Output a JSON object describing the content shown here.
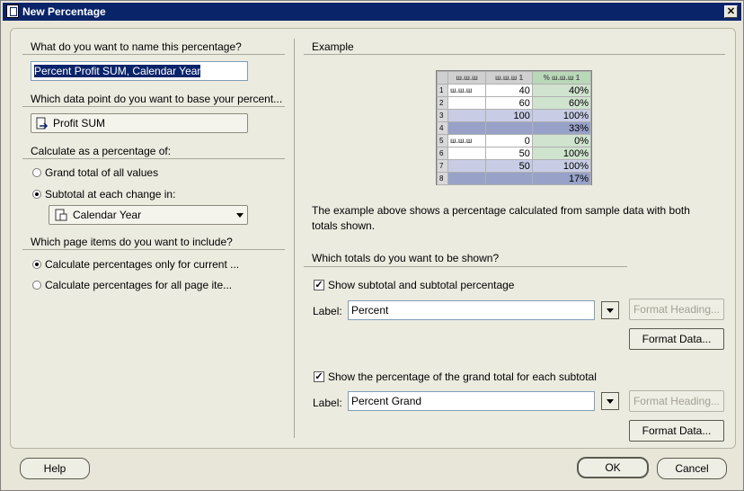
{
  "title": "New Percentage",
  "left": {
    "name_question": "What do you want to name this percentage?",
    "name_value": "Percent Profit SUM, Calendar Year",
    "datapoint_question": "Which data point do you want to base your percent...",
    "datapoint_value": "Profit SUM",
    "calc_question": "Calculate as a percentage of:",
    "calc_options": [
      "Grand total of all values",
      "Subtotal at each change in:"
    ],
    "subtotal_item": "Calendar Year",
    "page_question": "Which page items do you want to include?",
    "page_options": [
      "Calculate percentages only for current ...",
      "Calculate percentages for all page ite..."
    ]
  },
  "right": {
    "example_header": "Example",
    "example_table": {
      "headers": [
        "ш.ш.ш",
        "ш.ш.ш 1",
        "% ш.ш.ш 1"
      ],
      "rows": [
        {
          "n": "1",
          "a": "ш.ш.ш",
          "b": "40",
          "c": "40%"
        },
        {
          "n": "2",
          "a": "",
          "b": "60",
          "c": "60%"
        },
        {
          "n": "3",
          "a": "",
          "b": "100",
          "c": "100%"
        },
        {
          "n": "4",
          "a": "",
          "b": "",
          "c": "33%"
        },
        {
          "n": "5",
          "a": "ш.ш.ш",
          "b": "0",
          "c": "0%"
        },
        {
          "n": "6",
          "a": "",
          "b": "50",
          "c": "100%"
        },
        {
          "n": "7",
          "a": "",
          "b": "50",
          "c": "100%"
        },
        {
          "n": "8",
          "a": "",
          "b": "",
          "c": "17%"
        }
      ]
    },
    "example_text": "The example above shows a percentage calculated from sample data with both totals shown.",
    "totals_question": "Which totals do you want to be shown?",
    "show_subtotal_label": "Show subtotal and subtotal percentage",
    "label_caption": "Label:",
    "subtotal_label_value": "Percent",
    "show_grand_label": "Show the percentage of the grand total for each subtotal",
    "grand_label_value": "Percent Grand",
    "format_heading": "Format Heading...",
    "format_data": "Format Data..."
  },
  "buttons": {
    "help": "Help",
    "ok": "OK",
    "cancel": "Cancel"
  }
}
